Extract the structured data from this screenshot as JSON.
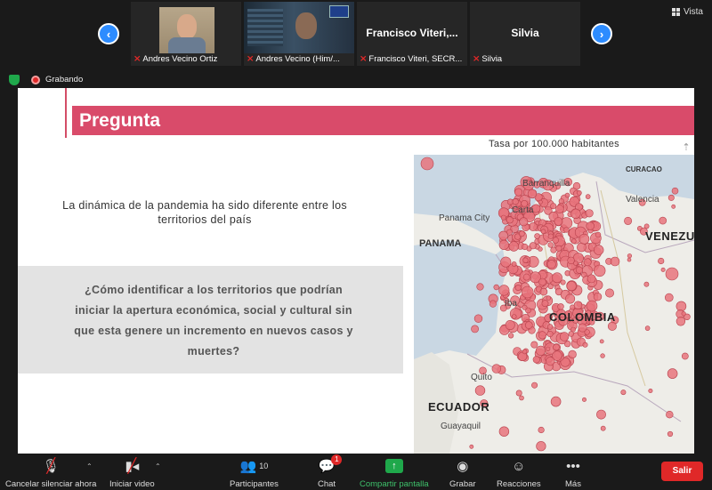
{
  "view_label": "Vista",
  "participants_strip": [
    {
      "name": "Andres Vecino Ortiz",
      "video": true
    },
    {
      "name": "Andres Vecino (Him/...",
      "video": true
    },
    {
      "name": "Francisco Viteri, SECR...",
      "display": "Francisco  Viteri,...",
      "video": false
    },
    {
      "name": "Silvia",
      "display": "Silvia",
      "video": false
    }
  ],
  "recording_label": "Grabando",
  "slide": {
    "title": "Pregunta",
    "intro": "La dinámica de la pandemia ha sido diferente entre los territorios del país",
    "question": "¿Cómo identificar a los territorios que podrían iniciar la apertura económica, social y cultural sin que esta genere un incremento en nuevos casos y muertes?",
    "map_title": "Tasa por 100.000 habitantes",
    "map_labels": {
      "curacao": "CURACAO",
      "barranquilla": "Barranquilla",
      "cartagena": "Carta",
      "valencia": "Valencia",
      "panama_city": "Panama City",
      "panama": "PANAMA",
      "venezuela": "VENEZU",
      "colombia": "COLOMBIA",
      "ibague": "Iba",
      "quito": "Quito",
      "ecuador": "ECUADOR",
      "guayaquil": "Guayaquil"
    },
    "marker_color": "#e8747c"
  },
  "toolbar": {
    "mute": "Cancelar silenciar ahora",
    "video": "Iniciar video",
    "participants": "Participantes",
    "participants_count": "10",
    "chat": "Chat",
    "chat_badge": "1",
    "share": "Compartir pantalla",
    "record": "Grabar",
    "reactions": "Reacciones",
    "more": "Más",
    "leave": "Salir"
  }
}
